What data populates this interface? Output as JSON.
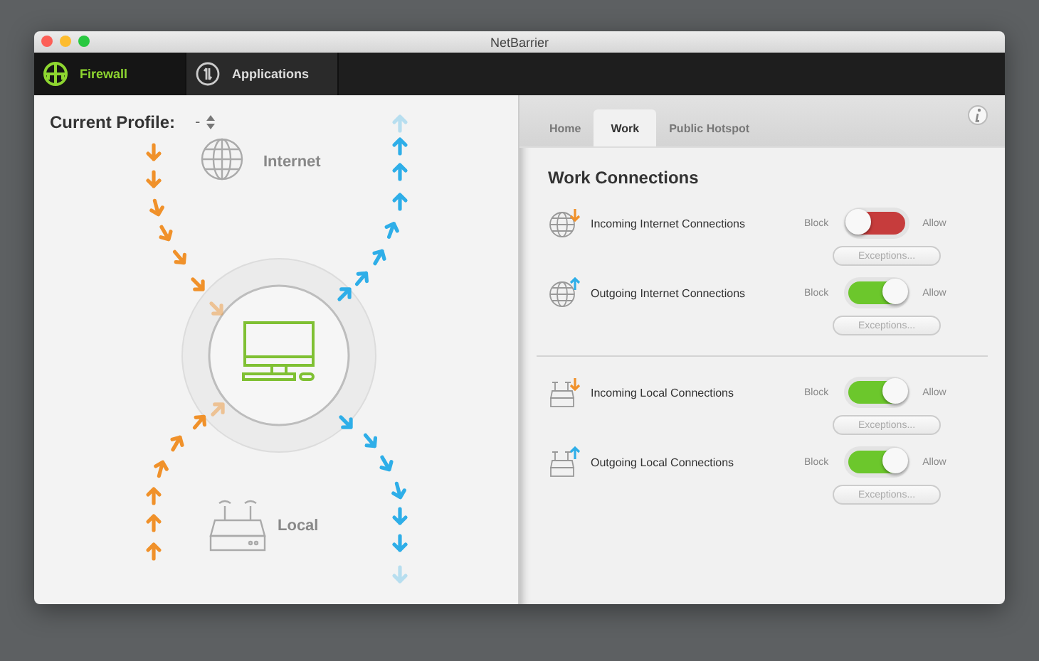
{
  "window": {
    "title": "NetBarrier"
  },
  "main_tabs": [
    {
      "label": "Firewall",
      "selected": true
    },
    {
      "label": "Applications",
      "selected": false
    }
  ],
  "profile": {
    "label": "Current Profile:",
    "value": "-"
  },
  "diagram": {
    "internet_label": "Internet",
    "local_label": "Local"
  },
  "profile_tabs": [
    {
      "label": "Home",
      "selected": false
    },
    {
      "label": "Work",
      "selected": true
    },
    {
      "label": "Public Hotspot",
      "selected": false
    }
  ],
  "heading": "Work Connections",
  "connections": [
    {
      "kind": "internet",
      "label": "Incoming Internet Connections",
      "block": "Block",
      "allow": "Allow",
      "allowed": false,
      "button": "Exceptions..."
    },
    {
      "kind": "internet",
      "label": "Outgoing Internet Connections",
      "block": "Block",
      "allow": "Allow",
      "allowed": true,
      "button": "Exceptions..."
    },
    {
      "kind": "local",
      "label": "Incoming Local Connections",
      "block": "Block",
      "allow": "Allow",
      "allowed": true,
      "button": "Exceptions..."
    },
    {
      "kind": "local",
      "label": "Outgoing Local Connections",
      "block": "Block",
      "allow": "Allow",
      "allowed": true,
      "button": "Exceptions..."
    }
  ]
}
